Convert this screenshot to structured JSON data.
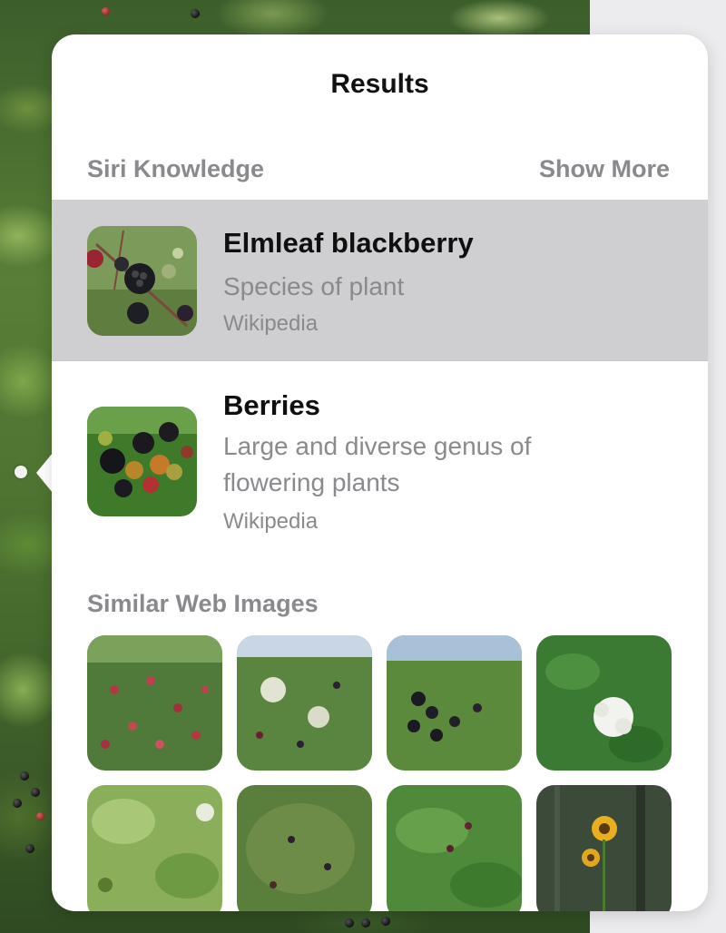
{
  "panel": {
    "title": "Results"
  },
  "siri_knowledge": {
    "heading": "Siri Knowledge",
    "show_more": "Show More",
    "results": [
      {
        "title": "Elmleaf blackberry",
        "subtitle": "Species of plant",
        "source": "Wikipedia",
        "selected": true
      },
      {
        "title": "Berries",
        "subtitle": "Large and diverse genus of flowering plants",
        "source": "Wikipedia",
        "selected": false
      }
    ]
  },
  "similar_images": {
    "heading": "Similar Web Images",
    "images": [
      {
        "description": "bramble-red-berries"
      },
      {
        "description": "bramble-bush-sky"
      },
      {
        "description": "blackberries-on-cane"
      },
      {
        "description": "white-flower-cluster"
      },
      {
        "description": "bramble-leaves"
      },
      {
        "description": "dense-bramble-thicket"
      },
      {
        "description": "bramble-hedge"
      },
      {
        "description": "sunflowers-forest"
      }
    ]
  },
  "colors": {
    "selected_row": "#cfcfd2",
    "secondary_text": "#8a8a8e",
    "panel_bg": "#ffffff"
  }
}
